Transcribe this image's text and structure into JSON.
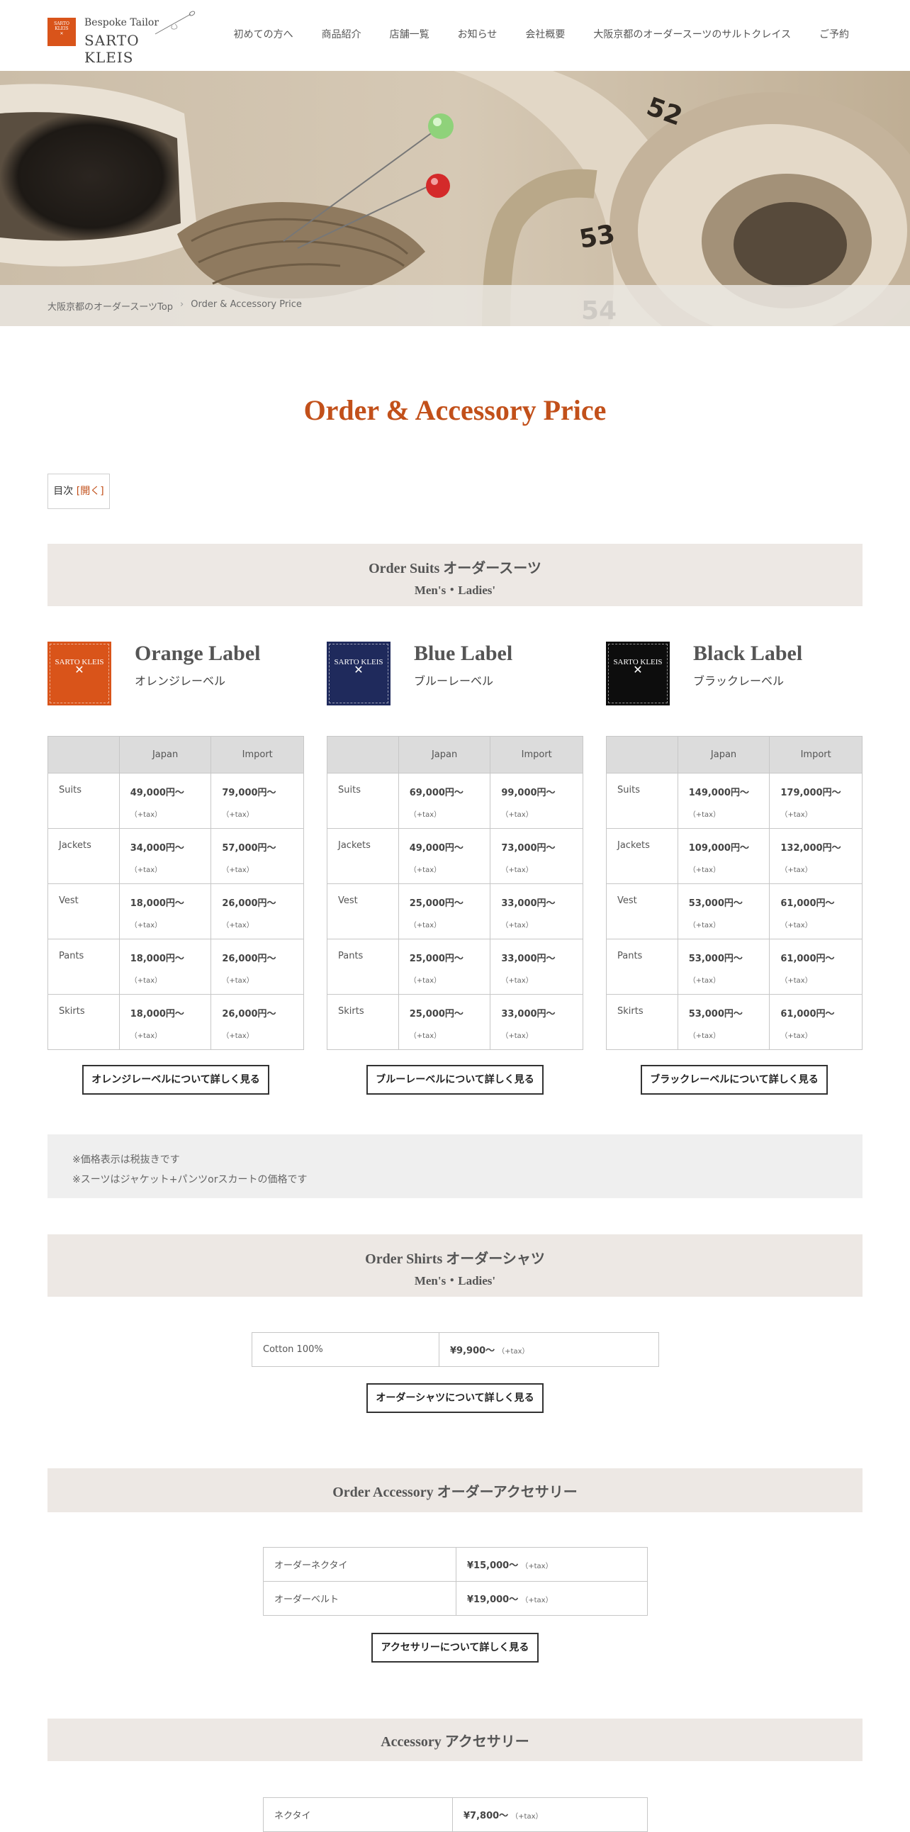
{
  "header": {
    "logo_sub": "Bespoke Tailor",
    "logo_main": "SARTO KLEIS",
    "nav": [
      "初めての方へ",
      "商品紹介",
      "店舗一覧",
      "お知らせ",
      "会社概要",
      "大阪京都のオーダースーツのサルトクレイス",
      "ご予約"
    ]
  },
  "breadcrumb": {
    "home": "大阪京都のオーダースーツTop",
    "sep": "›",
    "current": "Order & Accessory Price"
  },
  "page_title": "Order & Accessory Price",
  "toc": {
    "label": "目次",
    "open": "[開く]"
  },
  "sections": {
    "suits": {
      "title": "Order Suits オーダースーツ",
      "sub": "Men's・Ladies'"
    },
    "shirts": {
      "title": "Order Shirts オーダーシャツ",
      "sub": "Men's・Ladies'"
    },
    "accessory_order": {
      "title": "Order Accessory オーダーアクセサリー"
    },
    "accessory": {
      "title": "Accessory アクセサリー"
    }
  },
  "labels": [
    {
      "name": "Orange Label",
      "jp": "オレンジレーベル",
      "color": "#d9541a",
      "swatch_text": "SARTO KLEIS",
      "button": "オレンジレーベルについて詳しく見る"
    },
    {
      "name": "Blue Label",
      "jp": "ブルーレーベル",
      "color": "#1f2a5c",
      "swatch_text": "SARTO KLEIS",
      "button": "ブルーレーベルについて詳しく見る"
    },
    {
      "name": "Black Label",
      "jp": "ブラックレーベル",
      "color": "#0d0d0d",
      "swatch_text": "SARTO KLEIS",
      "button": "ブラックレーベルについて詳しく見る"
    }
  ],
  "price_table": {
    "headers": [
      "",
      "Japan",
      "Import"
    ],
    "tax": "（+tax）",
    "rows": [
      "Suits",
      "Jackets",
      "Vest",
      "Pants",
      "Skirts"
    ],
    "orange": [
      [
        "49,000円～",
        "79,000円～"
      ],
      [
        "34,000円～",
        "57,000円～"
      ],
      [
        "18,000円～",
        "26,000円～"
      ],
      [
        "18,000円～",
        "26,000円～"
      ],
      [
        "18,000円～",
        "26,000円～"
      ]
    ],
    "blue": [
      [
        "69,000円～",
        "99,000円～"
      ],
      [
        "49,000円～",
        "73,000円～"
      ],
      [
        "25,000円～",
        "33,000円～"
      ],
      [
        "25,000円～",
        "33,000円～"
      ],
      [
        "25,000円～",
        "33,000円～"
      ]
    ],
    "black": [
      [
        "149,000円～",
        "179,000円～"
      ],
      [
        "109,000円～",
        "132,000円～"
      ],
      [
        "53,000円～",
        "61,000円～"
      ],
      [
        "53,000円～",
        "61,000円～"
      ],
      [
        "53,000円～",
        "61,000円～"
      ]
    ]
  },
  "notes": [
    "※価格表示は税抜きです",
    "※スーツはジャケット+パンツorスカートの価格です"
  ],
  "shirts": {
    "item": "Cotton 100%",
    "price": "¥9,900〜",
    "tax": "（+tax）",
    "button": "オーダーシャツについて詳しく見る"
  },
  "order_accessory": {
    "rows": [
      {
        "item": "オーダーネクタイ",
        "price": "¥15,000〜",
        "tax": "（+tax）"
      },
      {
        "item": "オーダーベルト",
        "price": "¥19,000〜",
        "tax": "（+tax）"
      }
    ],
    "button": "アクセサリーについて詳しく見る"
  },
  "accessory": {
    "rows": [
      {
        "item": "ネクタイ",
        "price": "¥7,800〜",
        "tax": "（+tax）"
      }
    ]
  }
}
